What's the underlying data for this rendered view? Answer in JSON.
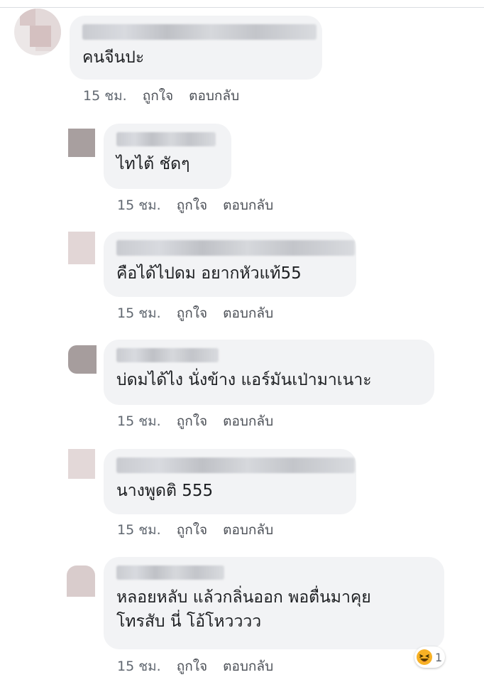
{
  "comments": [
    {
      "text": "คนจีนปะ",
      "time": "15 ชม.",
      "like": "ถูกใจ",
      "reply": "ตอบกลับ"
    },
    {
      "text": "ไทไต้ ชัดๆ",
      "time": "15 ชม.",
      "like": "ถูกใจ",
      "reply": "ตอบกลับ"
    },
    {
      "text": "คือได้ไปดม อยากหัวแท้55",
      "time": "15 ชม.",
      "like": "ถูกใจ",
      "reply": "ตอบกลับ"
    },
    {
      "text": "บ่ดมได้ไง นั่งข้าง แอร์มันเป่ามาเนาะ",
      "time": "15 ชม.",
      "like": "ถูกใจ",
      "reply": "ตอบกลับ"
    },
    {
      "text": "นางพูดติ 555",
      "time": "15 ชม.",
      "like": "ถูกใจ",
      "reply": "ตอบกลับ"
    },
    {
      "text_line1": "หลอยหลับ แล้วกลิ่นออก พอตื่นมาคุย",
      "text_line2": "โทรสับ นี่ โอ้โหวววว",
      "time": "15 ชม.",
      "like": "ถูกใจ",
      "reply": "ตอบกลับ",
      "reaction": {
        "icon": "haha-emoji-icon",
        "count": "1"
      }
    }
  ],
  "colors": {
    "bubble": "#f2f3f5",
    "text": "#1c1e21",
    "meta": "#4b4f56",
    "reaction_yellow": "#f7b125"
  }
}
